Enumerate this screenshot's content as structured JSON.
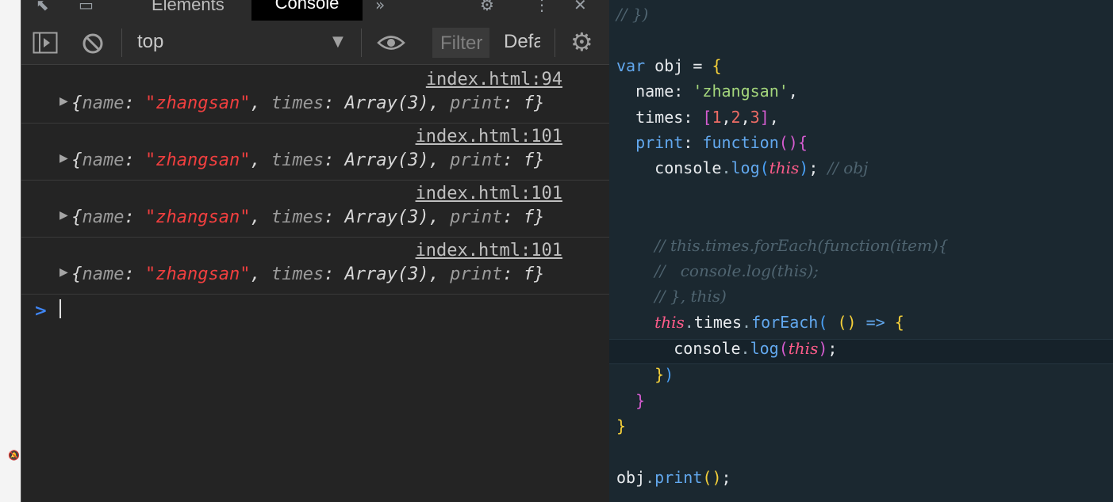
{
  "devtools": {
    "tabs": {
      "elements": "Elements",
      "console": "Console"
    },
    "toolbar": {
      "context": "top",
      "filter_placeholder": "Filter",
      "levels": "Default levels"
    },
    "messages": [
      {
        "source": "index.html:94",
        "name_key": "name",
        "name_value": "\"zhangsan\"",
        "times_key": "times",
        "times_value": "Array(3)",
        "print_key": "print",
        "print_value": "f"
      },
      {
        "source": "index.html:101",
        "name_key": "name",
        "name_value": "\"zhangsan\"",
        "times_key": "times",
        "times_value": "Array(3)",
        "print_key": "print",
        "print_value": "f"
      },
      {
        "source": "index.html:101",
        "name_key": "name",
        "name_value": "\"zhangsan\"",
        "times_key": "times",
        "times_value": "Array(3)",
        "print_key": "print",
        "print_value": "f"
      },
      {
        "source": "index.html:101",
        "name_key": "name",
        "name_value": "\"zhangsan\"",
        "times_key": "times",
        "times_value": "Array(3)",
        "print_key": "print",
        "print_value": "f"
      }
    ],
    "prompt_symbol": ">"
  },
  "editor": {
    "lines": [
      "// })",
      "",
      "var obj = {",
      "  name: 'zhangsan',",
      "  times: [1,2,3],",
      "  print: function(){",
      "    console.log(this); // obj",
      "",
      "",
      "    // this.times.forEach(function(item){",
      "    //   console.log(this);",
      "    // }, this)",
      "    this.times.forEach( () => {",
      "      console.log(this);",
      "    })",
      "  }",
      "}",
      "",
      "obj.print();"
    ]
  },
  "colors": {
    "devtools_bg": "#242424",
    "editor_bg": "#1b2830",
    "string_red": "#f13f3f",
    "prompt_blue": "#3f86f5",
    "keyword_blue": "#62a8ee",
    "string_green": "#a4d67c",
    "this_pink": "#ff5c8a"
  },
  "icons": [
    "inspect-icon",
    "device-toggle-icon",
    "more-tabs-icon",
    "gear-icon",
    "kebab-menu-icon",
    "close-icon",
    "sidebar-toggle-icon",
    "clear-console-icon",
    "dropdown-caret-icon",
    "eye-icon",
    "settings-gear-icon",
    "expand-triangle-icon",
    "prompt-chevron-icon",
    "muted-bell-icon"
  ]
}
